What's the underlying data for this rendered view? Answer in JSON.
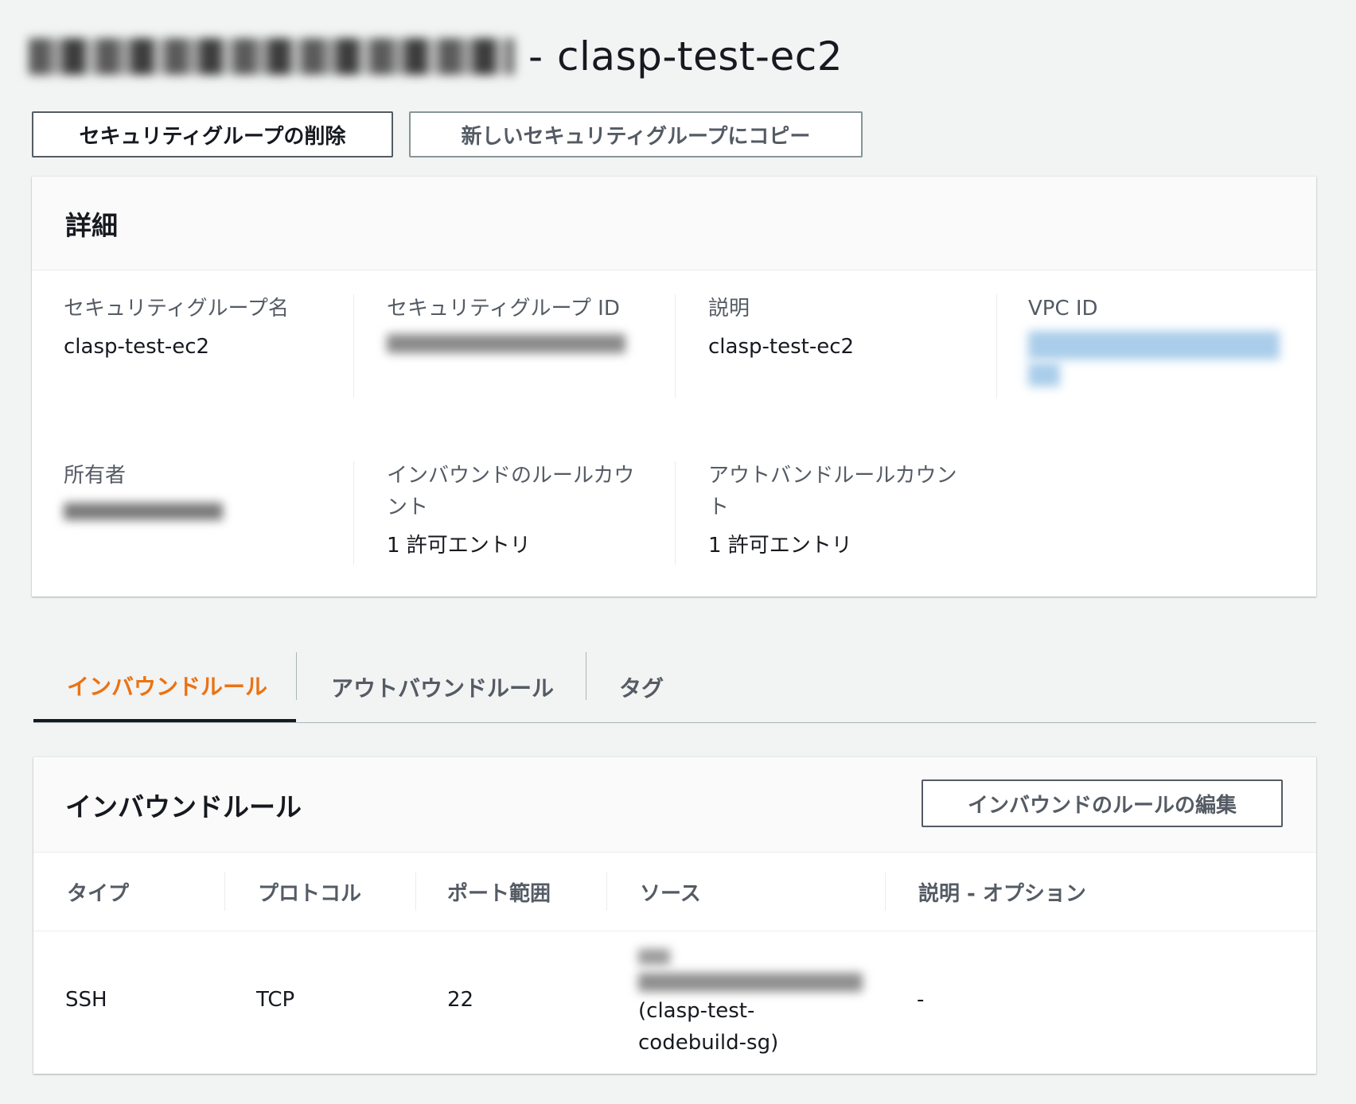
{
  "header": {
    "title_suffix": "clasp-test-ec2",
    "separator": "-"
  },
  "actions": {
    "delete_label": "セキュリティグループの削除",
    "copy_label": "新しいセキュリティグループにコピー"
  },
  "details": {
    "title": "詳細",
    "fields": {
      "sg_name": {
        "label": "セキュリティグループ名",
        "value": "clasp-test-ec2"
      },
      "sg_id": {
        "label": "セキュリティグループ ID"
      },
      "description": {
        "label": "説明",
        "value": "clasp-test-ec2"
      },
      "vpc_id": {
        "label": "VPC ID"
      },
      "owner": {
        "label": "所有者"
      },
      "inbound_count": {
        "label": "インバウンドのルールカウント",
        "value": "1 許可エントリ"
      },
      "outbound_count": {
        "label": "アウトバンドルールカウント",
        "value": "1 許可エントリ"
      }
    }
  },
  "tabs": {
    "inbound": "インバウンドルール",
    "outbound": "アウトバウンドルール",
    "tags": "タグ"
  },
  "inbound_rules": {
    "title": "インバウンドルール",
    "edit_label": "インバウンドのルールの編集",
    "columns": [
      "タイプ",
      "プロトコル",
      "ポート範囲",
      "ソース",
      "説明 - オプション"
    ],
    "rows": [
      {
        "type": "SSH",
        "protocol": "TCP",
        "port": "22",
        "source_name": "(clasp-test-codebuild-sg)",
        "description": "-"
      }
    ]
  },
  "colors": {
    "accent": "#ec7211",
    "background": "#f2f3f3",
    "link_blur": "#a9cdea"
  }
}
